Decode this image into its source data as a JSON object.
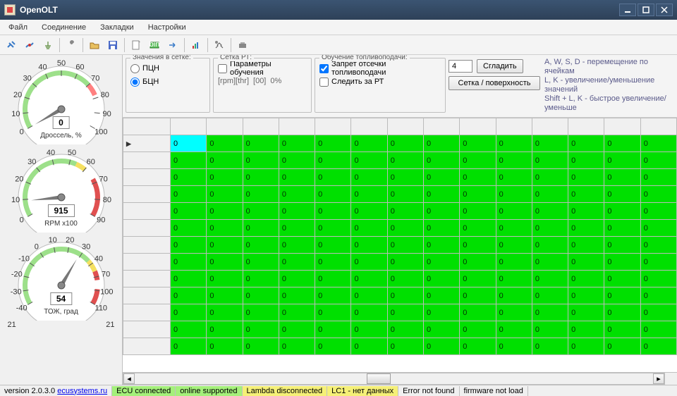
{
  "title": "OpenOLT",
  "menu": [
    "Файл",
    "Соединение",
    "Закладки",
    "Настройки"
  ],
  "controls_panel": {
    "group_values": {
      "title": "Значения в сетке:",
      "radio_pcn": "ПЦН",
      "radio_bcn": "БЦН",
      "selected": "bcn"
    },
    "group_rt": {
      "title": "Сетка РТ:",
      "chk_params": "Параметры обучения",
      "rpm_thr": "[rpm][thr]",
      "rpm_val": "[00]",
      "rpm_pct": "0%"
    },
    "group_fuel": {
      "title": "Обучение топливоподачи:",
      "chk_cutoff": "Запрет отсечки топливоподачи",
      "chk_cutoff_checked": true,
      "chk_follow": "Следить за РТ"
    },
    "smooth_val": "4",
    "btn_smooth": "Сгладить",
    "btn_surface": "Сетка / поверхность",
    "hints": [
      "A, W, S, D - перемещение по ячейкам",
      "L, K - увеличение/уменьшение значений",
      "Shift + L, K - быстрое увеличение/уменьше"
    ]
  },
  "gauges": {
    "throttle": {
      "value": "0",
      "label": "Дроссель, %",
      "ticks": [
        "0",
        "10",
        "20",
        "30",
        "40",
        "50",
        "60",
        "70",
        "80",
        "90",
        "100"
      ]
    },
    "rpm": {
      "value": "915",
      "label": "RPM x100",
      "ticks": [
        "0",
        "10",
        "20",
        "30",
        "40",
        "50",
        "60",
        "70",
        "80",
        "90"
      ]
    },
    "temp": {
      "value": "54",
      "label": "ТОЖ, град",
      "ticks": [
        "-40",
        "-30",
        "-20",
        "-10",
        "0",
        "10",
        "20",
        "30",
        "40",
        "70",
        "100",
        "110"
      ]
    },
    "bottom_left": "21",
    "bottom_right": "21"
  },
  "table": {
    "cols": 14,
    "rows": 13,
    "cell_value": "0"
  },
  "status": {
    "version": "version 2.0.3.0",
    "link": "ecusystems.ru",
    "ecu": "ECU connected",
    "online": "online supported",
    "lambda": "Lambda disconnected",
    "lc1": "LC1 - нет данных",
    "error": "Error not found",
    "firmware": "firmware not load"
  },
  "chart_data": [
    {
      "type": "gauge",
      "name": "throttle",
      "value": 0,
      "min": 0,
      "max": 100,
      "unit": "%",
      "label": "Дроссель, %"
    },
    {
      "type": "gauge",
      "name": "rpm",
      "value": 915,
      "min": 0,
      "max": 9000,
      "unit": "RPM",
      "label": "RPM x100",
      "display_scale": 100
    },
    {
      "type": "gauge",
      "name": "coolant",
      "value": 54,
      "min": -40,
      "max": 110,
      "unit": "°C",
      "label": "ТОЖ, град"
    },
    {
      "type": "table",
      "name": "fuel-grid",
      "rows": 13,
      "cols": 14,
      "values_uniform": 0
    }
  ]
}
